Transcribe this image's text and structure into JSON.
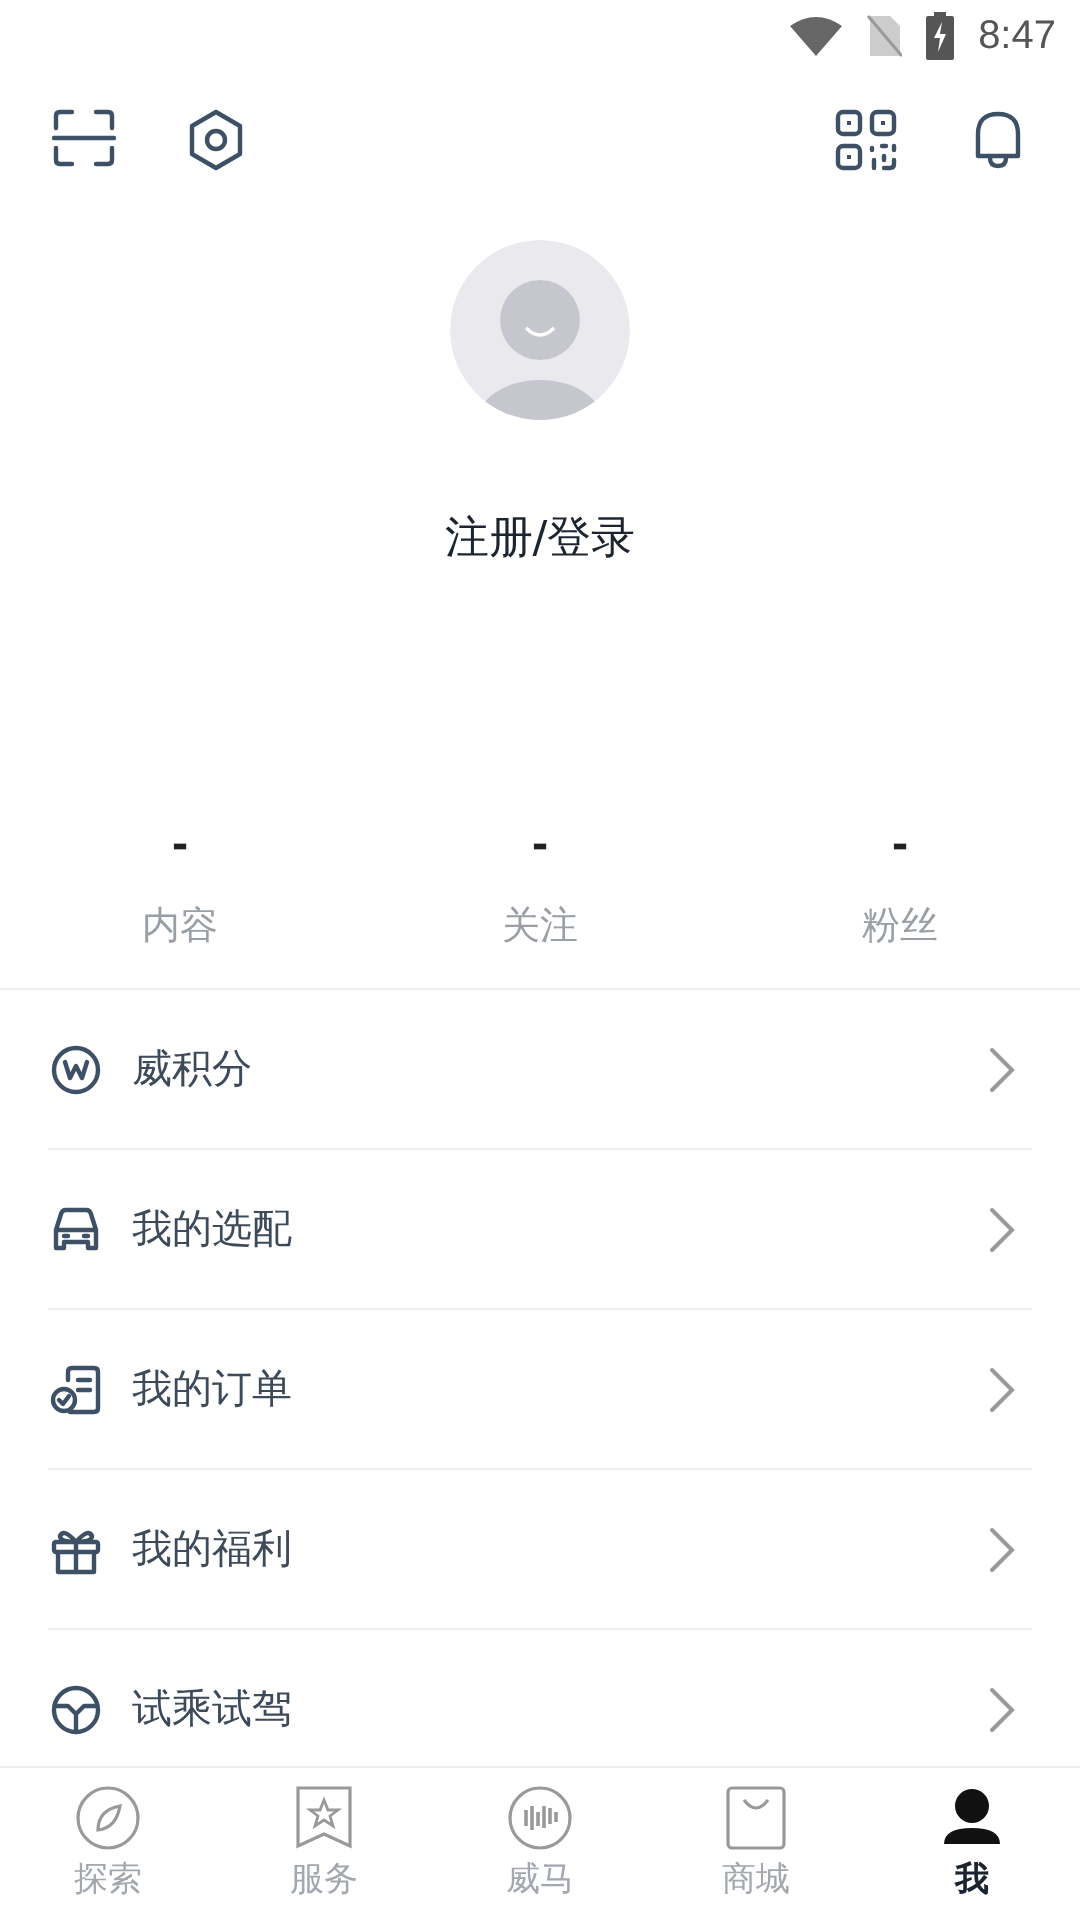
{
  "status_bar": {
    "time": "8:47"
  },
  "profile": {
    "login": "注册/登录"
  },
  "stats": [
    {
      "value": "-",
      "label": "内容"
    },
    {
      "value": "-",
      "label": "关注"
    },
    {
      "value": "-",
      "label": "粉丝"
    }
  ],
  "menu": [
    {
      "kind": "points",
      "label": "威积分"
    },
    {
      "kind": "car",
      "label": "我的选配"
    },
    {
      "kind": "order",
      "label": "我的订单"
    },
    {
      "kind": "gift",
      "label": "我的福利"
    },
    {
      "kind": "wheel",
      "label": "试乘试驾"
    }
  ],
  "tabs": [
    {
      "kind": "explore",
      "label": "探索",
      "selected": false
    },
    {
      "kind": "service",
      "label": "服务",
      "selected": false
    },
    {
      "kind": "brand",
      "label": "威马",
      "selected": false
    },
    {
      "kind": "shop",
      "label": "商城",
      "selected": false
    },
    {
      "kind": "me",
      "label": "我",
      "selected": true
    }
  ]
}
